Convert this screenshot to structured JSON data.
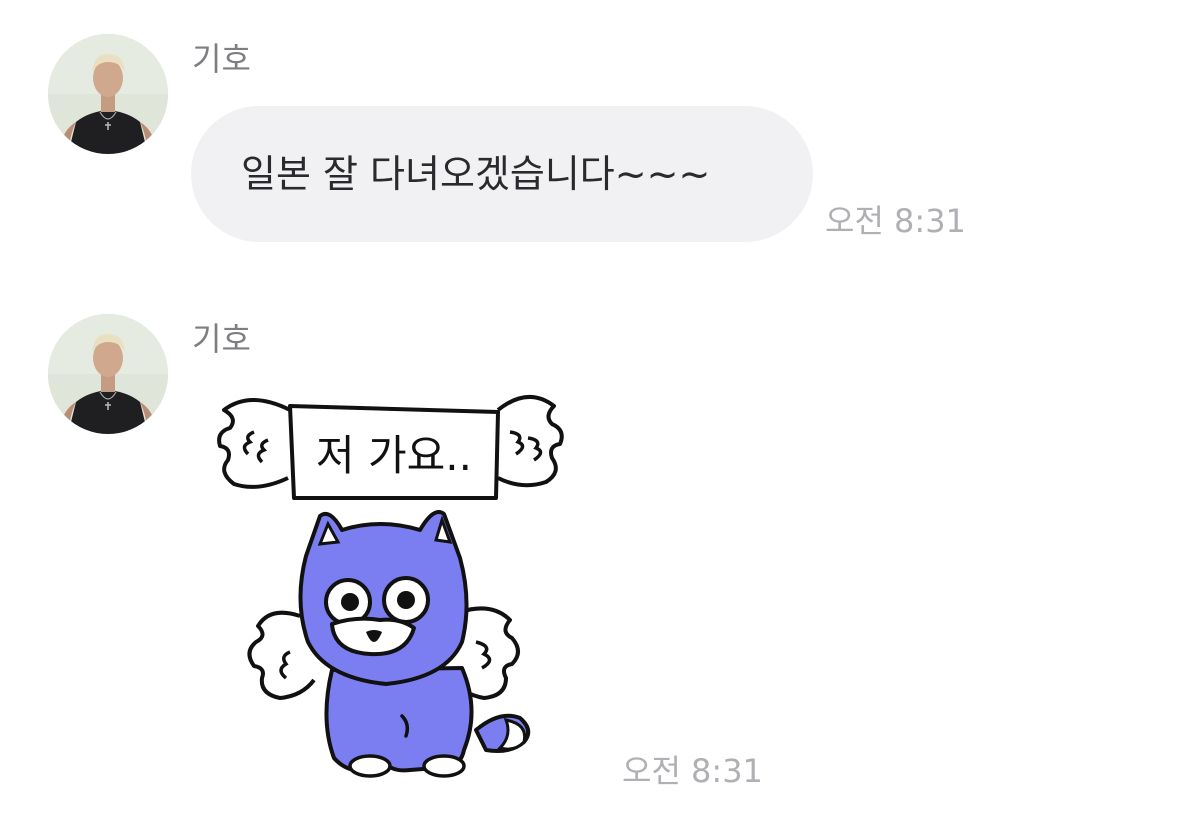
{
  "colors": {
    "background": "#ffffff",
    "bubble": "#f1f1f3",
    "name_text": "#7d7d82",
    "time_text": "#b0b0b4",
    "sticker_fox": "#7b7ef0"
  },
  "messages": [
    {
      "sender": "기호",
      "type": "text",
      "text": "일본 잘 다녀오겠습니다~~~",
      "time": "오전 8:31"
    },
    {
      "sender": "기호",
      "type": "sticker",
      "sticker": {
        "icon": "winged-blue-fox-sticker",
        "sign_text": "저 가요.."
      },
      "time": "오전 8:31"
    }
  ]
}
